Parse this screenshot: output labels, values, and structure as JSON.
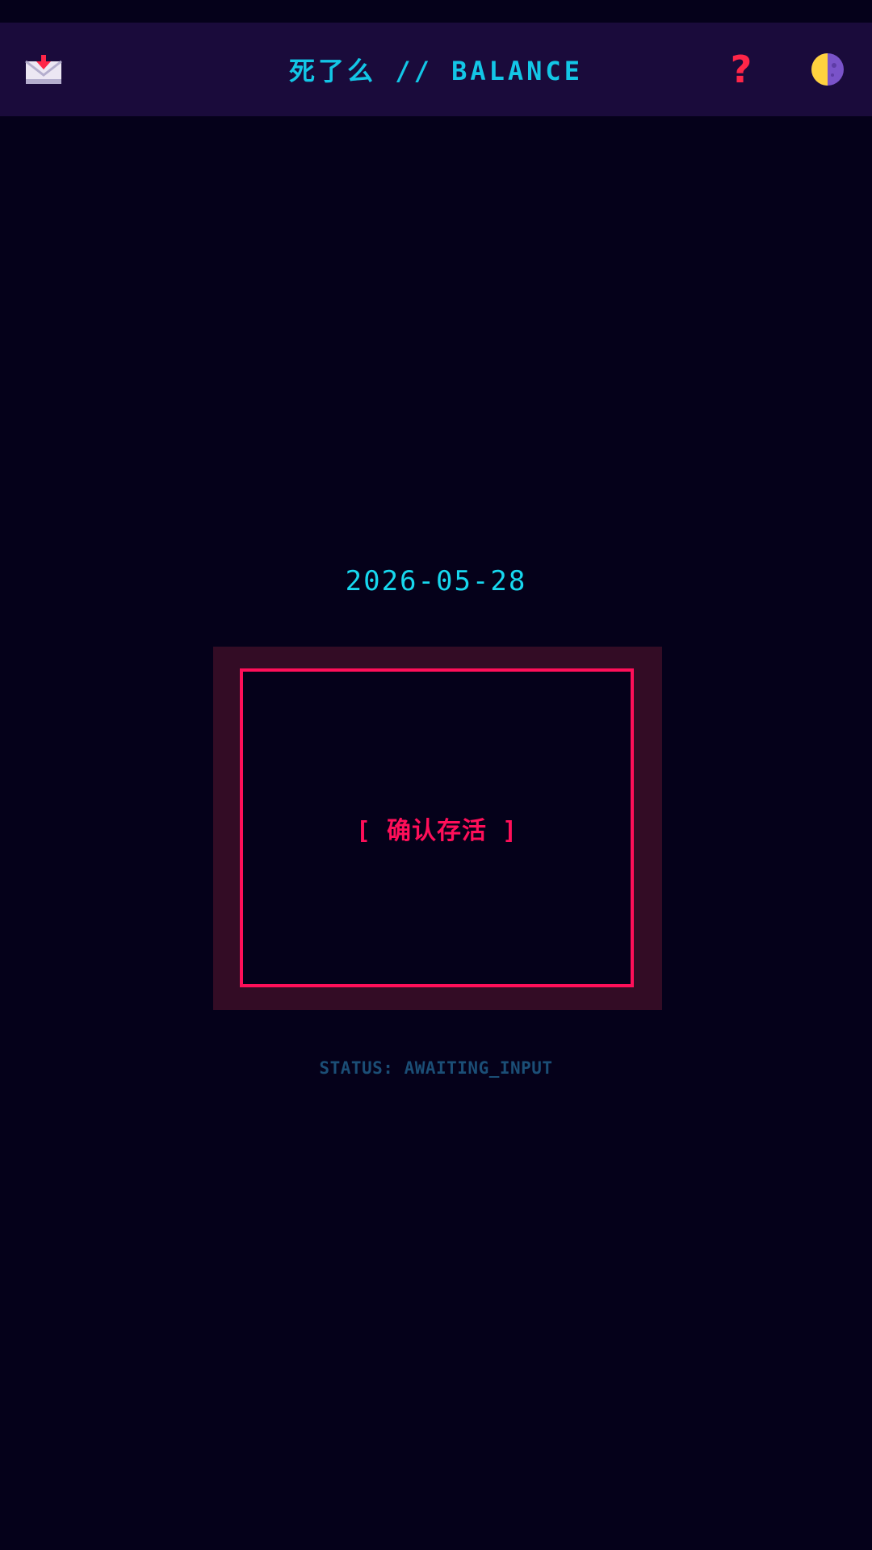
{
  "header": {
    "title": "死了么 // BALANCE",
    "inbox_icon": "inbox-download-icon",
    "help_icon": "question-mark-icon",
    "help_glyph": "?",
    "theme_icon": "theme-toggle-icon"
  },
  "main": {
    "date": "2026-05-28",
    "confirm_label": "[ 确认存活 ]",
    "status": "STATUS: AWAITING_INPUT"
  },
  "colors": {
    "background": "#05011a",
    "header_bg": "#1a0b3b",
    "accent_cyan": "#13c6e6",
    "accent_red": "#ff0f59",
    "confirm_shadow": "#330c25",
    "status_text": "#1b4e76",
    "help_red": "#ff2648",
    "theme_yellow": "#ffd23f",
    "theme_purple": "#7a53c9"
  }
}
